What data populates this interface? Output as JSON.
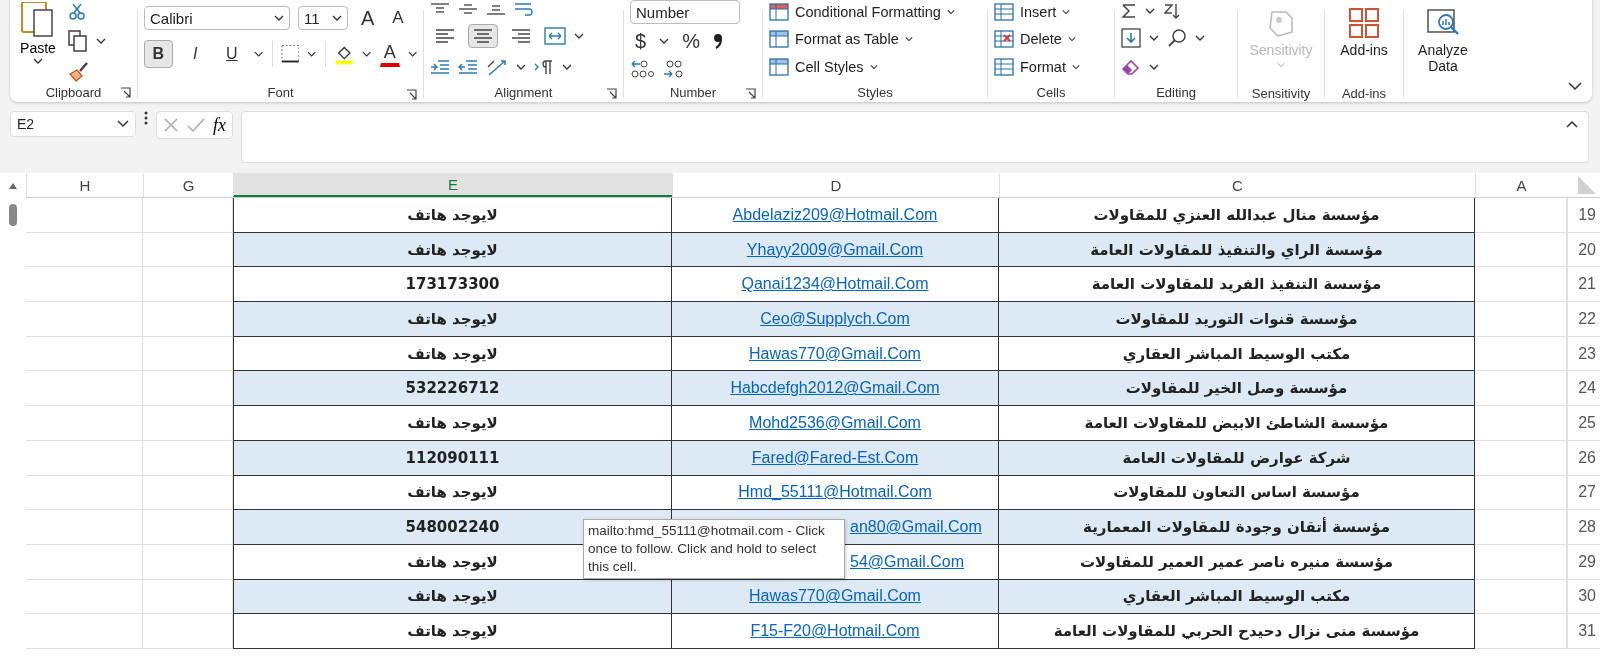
{
  "ribbon": {
    "clipboard": {
      "paste": "Paste",
      "label": "Clipboard"
    },
    "font": {
      "name": "Calibri",
      "size": "11",
      "grow": "A",
      "shrink": "A",
      "bold": {
        "label": "B",
        "selected": true
      },
      "italic": {
        "label": "I",
        "selected": false
      },
      "underline": {
        "label": "U",
        "selected": false
      },
      "font_color": "A",
      "label": "Font"
    },
    "alignment": {
      "align_left": {
        "selected": false
      },
      "align_center": {
        "selected": true
      },
      "align_right": {
        "selected": false
      },
      "label": "Alignment"
    },
    "number": {
      "format": "Number",
      "currency": "$",
      "percent": "%",
      "label": "Number"
    },
    "styles": {
      "items": [
        "Conditional Formatting",
        "Format as Table",
        "Cell Styles"
      ],
      "label": "Styles"
    },
    "cells": {
      "items": [
        "Insert",
        "Delete",
        "Format"
      ],
      "label": "Cells"
    },
    "editing": {
      "label": "Editing"
    },
    "sensitivity": {
      "button": "Sensitivity",
      "disabled": true,
      "label": "Sensitivity"
    },
    "addins": {
      "button": "Add-ins",
      "label": "Add-ins"
    },
    "analyze": {
      "button": "Analyze Data"
    }
  },
  "formula_bar": {
    "name_box": "E2",
    "fx": "fx"
  },
  "columns": [
    {
      "label": "A",
      "selected": false
    },
    {
      "label": "C",
      "selected": false
    },
    {
      "label": "D",
      "selected": false
    },
    {
      "label": "E",
      "selected": true
    },
    {
      "label": "G",
      "selected": false
    },
    {
      "label": "H",
      "selected": false
    }
  ],
  "rows": [
    {
      "number": "19",
      "banded": false,
      "company": "مؤسسة منال عبدالله العنزي للمقاولات",
      "email": "Abdelaziz209@Hotmail.Com",
      "email_cut": false,
      "phone": "لايوجد هاتف"
    },
    {
      "number": "20",
      "banded": true,
      "company": "مؤسسة الراي والتنفيذ للمقاولات العامة",
      "email": "Yhayy2009@Gmail.Com",
      "email_cut": false,
      "phone": "لايوجد هاتف"
    },
    {
      "number": "21",
      "banded": false,
      "company": "مؤسسة التنفيذ الفريد للمقاولات العامة",
      "email": "Qanai1234@Hotmail.Com",
      "email_cut": false,
      "phone": "173173300"
    },
    {
      "number": "22",
      "banded": true,
      "company": "مؤسسة قنوات التوريد للمقاولات",
      "email": "Ceo@Supplych.Com",
      "email_cut": false,
      "phone": "لايوجد هاتف"
    },
    {
      "number": "23",
      "banded": false,
      "company": "مكتب الوسيط المباشر العقاري",
      "email": "Hawas770@Gmail.Com",
      "email_cut": false,
      "phone": "لايوجد هاتف"
    },
    {
      "number": "24",
      "banded": true,
      "company": "مؤسسة وصل الخير للمقاولات",
      "email": "Habcdefgh2012@Gmail.Com",
      "email_cut": false,
      "phone": "532226712"
    },
    {
      "number": "25",
      "banded": false,
      "company": "مؤسسة الشاطئ الابيض للمقاولات العامة",
      "email": "Mohd2536@Gmail.Com",
      "email_cut": false,
      "phone": "لايوجد هاتف"
    },
    {
      "number": "26",
      "banded": true,
      "company": "شركة عوارض للمقاولات العامة",
      "email": "Fared@Fared-Est.Com",
      "email_cut": false,
      "phone": "112090111"
    },
    {
      "number": "27",
      "banded": false,
      "company": "مؤسسة اساس التعاون للمقاولات",
      "email": "Hmd_55111@Hotmail.Com",
      "email_cut": false,
      "phone": "لايوجد هاتف"
    },
    {
      "number": "28",
      "banded": true,
      "company": "مؤسسة أتقان وجودة للمقاولات المعمارية",
      "email": "an80@Gmail.Com",
      "email_cut": true,
      "phone": "548002240"
    },
    {
      "number": "29",
      "banded": false,
      "company": "مؤسسة منيره ناصر عمير العمير للمقاولات",
      "email": "54@Gmail.Com",
      "email_cut": true,
      "phone": "لايوجد هاتف"
    },
    {
      "number": "30",
      "banded": true,
      "company": "مكتب الوسيط المباشر العقاري",
      "email": "Hawas770@Gmail.Com",
      "email_cut": false,
      "phone": "لايوجد هاتف"
    },
    {
      "number": "31",
      "banded": false,
      "company": "مؤسسة منى نزال دحيدح الحربي للمقاولات العامة",
      "email": "F15-F20@Hotmail.Com",
      "email_cut": false,
      "phone": "لايوجد هاتف"
    }
  ],
  "tooltip": "mailto:hmd_55111@hotmail.com - Click once to follow. Click and hold to select this cell."
}
